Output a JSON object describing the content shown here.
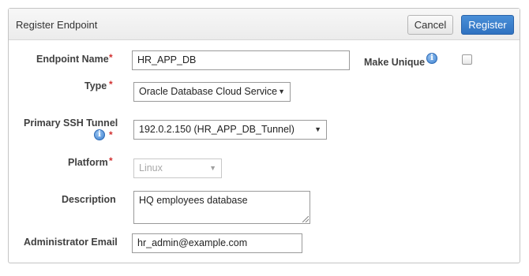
{
  "dialog": {
    "title": "Register Endpoint",
    "cancel_label": "Cancel",
    "register_label": "Register"
  },
  "form": {
    "endpoint_name": {
      "label": "Endpoint Name",
      "value": "HR_APP_DB"
    },
    "make_unique": {
      "label": "Make Unique",
      "checked": false
    },
    "type": {
      "label": "Type",
      "value": "Oracle Database Cloud Service"
    },
    "ssh_tunnel": {
      "label": "Primary SSH Tunnel",
      "value": "192.0.2.150 (HR_APP_DB_Tunnel)"
    },
    "platform": {
      "label": "Platform",
      "value": "Linux"
    },
    "description": {
      "label": "Description",
      "value": "HQ employees database"
    },
    "admin_email": {
      "label": "Administrator Email",
      "value": "hr_admin@example.com"
    }
  },
  "required_marker": "*",
  "icons": {
    "info": "info-icon",
    "dropdown": "chevron-down-icon"
  },
  "colors": {
    "accent": "#2f72c1",
    "required": "#d23030"
  }
}
